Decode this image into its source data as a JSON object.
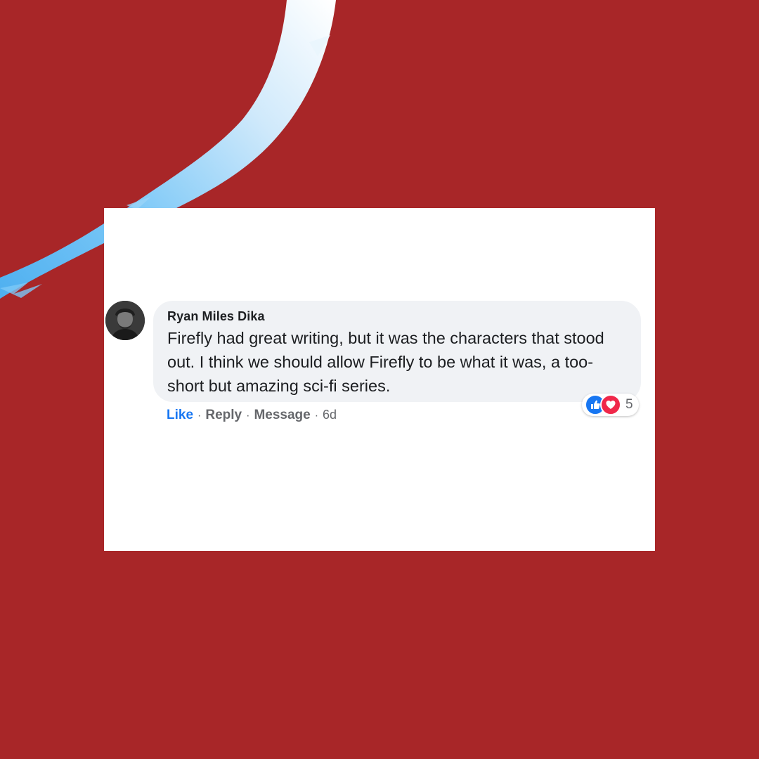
{
  "comment": {
    "author": "Ryan Miles Dika",
    "text": "Firefly had great writing, but it was the characters that stood out. I think we should allow Firefly to be what it was, a too-short but amazing sci-fi series.",
    "actions": {
      "like": "Like",
      "reply": "Reply",
      "message": "Message",
      "timestamp": "6d",
      "separator": "·"
    },
    "reactions": {
      "count": "5",
      "types": [
        "like-icon",
        "love-icon"
      ]
    }
  },
  "colors": {
    "background": "#a82628",
    "card": "#ffffff",
    "bubble": "#f0f2f5",
    "like_blue": "#1877f2",
    "love_red": "#f0284a",
    "brush": "#5bb8f5"
  }
}
